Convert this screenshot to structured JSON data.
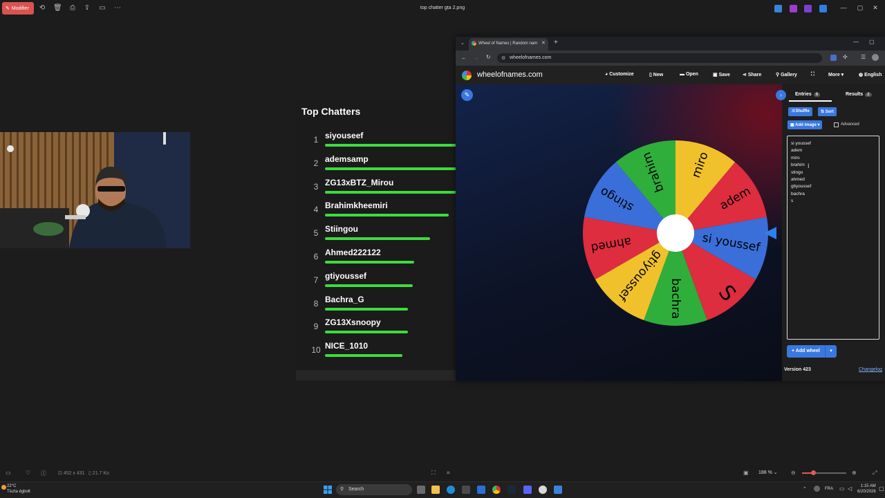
{
  "viewer": {
    "modify_label": "Modifier",
    "title": "top chatter gta 2.png",
    "image_size": "452 x 431",
    "file_size": "21.7 Ko",
    "zoom": "188 %"
  },
  "chatters": {
    "title": "Top Chatters",
    "items": [
      {
        "rank": "1",
        "name": "siyouseef",
        "level": 1.0
      },
      {
        "rank": "2",
        "name": "ademsamp",
        "level": 1.0
      },
      {
        "rank": "3",
        "name": "ZG13xBTZ_Mirou",
        "level": 1.0
      },
      {
        "rank": "4",
        "name": "Brahimkheemiri",
        "level": 0.94
      },
      {
        "rank": "5",
        "name": "Stiingou",
        "level": 0.8
      },
      {
        "rank": "6",
        "name": "Ahmed222122",
        "level": 0.68
      },
      {
        "rank": "7",
        "name": "gtiyoussef",
        "level": 0.67
      },
      {
        "rank": "8",
        "name": "Bachra_G",
        "level": 0.63
      },
      {
        "rank": "9",
        "name": "ZG13Xsnoopy",
        "level": 0.63
      },
      {
        "rank": "10",
        "name": "NICE_1010",
        "level": 0.59
      }
    ]
  },
  "browser": {
    "tab_title": "Wheel of Names | Random nam",
    "url": "wheelofnames.com",
    "site_name": "wheelofnames.com",
    "nav": {
      "customize": "Customize",
      "new": "New",
      "open": "Open",
      "save": "Save",
      "share": "Share",
      "gallery": "Gallery",
      "more": "More",
      "language": "English"
    }
  },
  "wheel": {
    "colors": {
      "blue": "#3a6fd9",
      "red": "#dd2d3f",
      "yellow": "#f1c12b",
      "green": "#2fae3c"
    },
    "slices": [
      {
        "label": "si youssef",
        "color": "blue"
      },
      {
        "label": "S",
        "color": "red"
      },
      {
        "label": "bachra",
        "color": "green"
      },
      {
        "label": "gtiyoussef",
        "color": "yellow"
      },
      {
        "label": "ahmed",
        "color": "red"
      },
      {
        "label": "stingo",
        "color": "blue"
      },
      {
        "label": "brahim",
        "color": "green"
      },
      {
        "label": "miro",
        "color": "yellow"
      },
      {
        "label": "adem",
        "color": "red"
      }
    ]
  },
  "panel": {
    "entries_tab": "Entries",
    "entries_count": "9",
    "results_tab": "Results",
    "results_count": "2",
    "shuffle": "Shuffle",
    "sort": "Sort",
    "add_image": "Add image",
    "advanced": "Advanced",
    "entries": [
      "si youssef",
      "adem",
      "miro",
      "brahim",
      "stingo",
      "ahmed",
      "gtiyoussef",
      "bachra",
      "s"
    ],
    "add_wheel": "Add wheel",
    "version": "Version 423",
    "changelog": "Changelog"
  },
  "taskbar": {
    "temperature": "22°C",
    "weather_text": "Tiszta égbolt",
    "search_placeholder": "Search",
    "language": "FRA",
    "time": "1:15 AM",
    "date": "6/20/2026"
  }
}
